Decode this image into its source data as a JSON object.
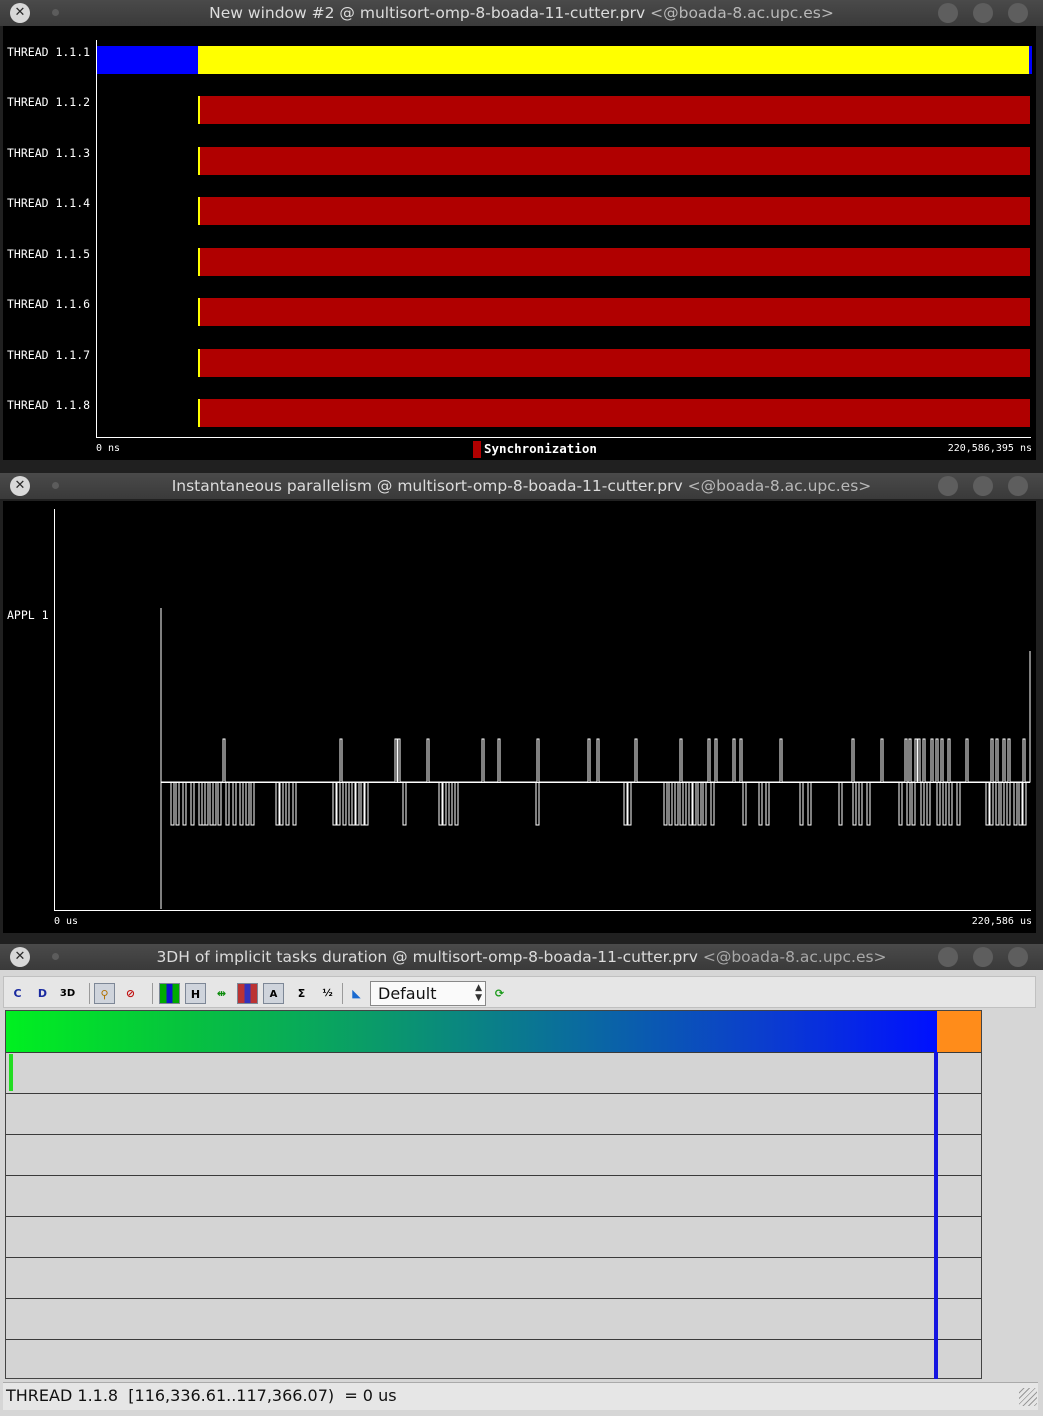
{
  "windows": {
    "timeline": {
      "title": "New window #2 @ multisort-omp-8-boada-11-cutter.prv",
      "host": "<@boada-8.ac.upc.es>",
      "threads": [
        "THREAD 1.1.1",
        "THREAD 1.1.2",
        "THREAD 1.1.3",
        "THREAD 1.1.4",
        "THREAD 1.1.5",
        "THREAD 1.1.6",
        "THREAD 1.1.7",
        "THREAD 1.1.8"
      ],
      "time_start": "0 ns",
      "time_end": "220,586,395 ns",
      "legend_label": "Synchronization",
      "colors": {
        "running": "#ffff00",
        "idle": "#0000ff",
        "synchronization": "#b00000"
      }
    },
    "parallelism": {
      "title": "Instantaneous parallelism @ multisort-omp-8-boada-11-cutter.prv",
      "host": "<@boada-8.ac.upc.es>",
      "row_label": "APPL 1",
      "time_start": "0 us",
      "time_end": "220,586 us"
    },
    "histogram": {
      "title": "3DH of implicit tasks duration @ multisort-omp-8-boada-11-cutter.prv",
      "host": "<@boada-8.ac.upc.es>",
      "toolbar": {
        "icons": [
          "open-control-icon",
          "open-data-icon",
          "open-3d-icon",
          "zoom-icon",
          "clear-zoom-icon",
          "color-mode-icon",
          "horizontal-icon",
          "hide-empty-icon",
          "gradient-icon",
          "label-icon",
          "totals-icon",
          "sort-icon",
          "semantic-icon",
          "refresh-icon"
        ],
        "view_select": "Default"
      },
      "status_text": "THREAD 1.1.8  [116,336.61..117,366.07)  = 0 us",
      "colors": {
        "gradient_start": "#00f020",
        "gradient_end": "#0010ff",
        "overflow": "#ff8c1a"
      }
    }
  }
}
